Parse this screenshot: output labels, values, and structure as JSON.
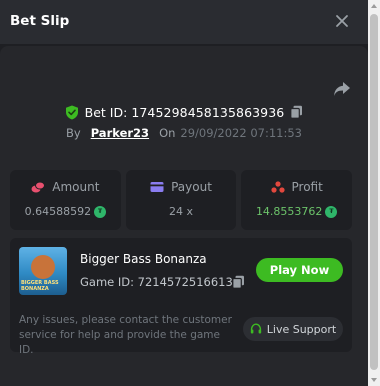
{
  "header": {
    "title": "Bet Slip"
  },
  "bet": {
    "id_label": "Bet ID:",
    "id_value": "1745298458135863936",
    "by_label": "By",
    "username": "Parker23",
    "on_label": "On",
    "datetime": "29/09/2022 07:11:53"
  },
  "stats": {
    "amount_label": "Amount",
    "amount_value": "0.64588592",
    "payout_label": "Payout",
    "payout_value": "24 x",
    "profit_label": "Profit",
    "profit_value": "14.8553762"
  },
  "game": {
    "name": "Bigger Bass Bonanza",
    "id_text": "Game ID: 7214572516613",
    "thumb_text": "BIGGER BASS BONANZA",
    "play_label": "Play Now",
    "notice": "Any issues, please contact the customer service for help and provide the game ID.",
    "support_label": "Live Support"
  },
  "colors": {
    "accent_green": "#3dbb22",
    "profit_green": "#6cc36a",
    "amount_icon": "#e8506f",
    "payout_icon": "#8a7df0",
    "profit_icon": "#e2483e"
  },
  "icons": [
    "close-icon",
    "share-icon",
    "shield-check-icon",
    "copy-icon",
    "coins-icon",
    "card-icon",
    "chart-icon",
    "coin-icon",
    "headset-icon"
  ]
}
